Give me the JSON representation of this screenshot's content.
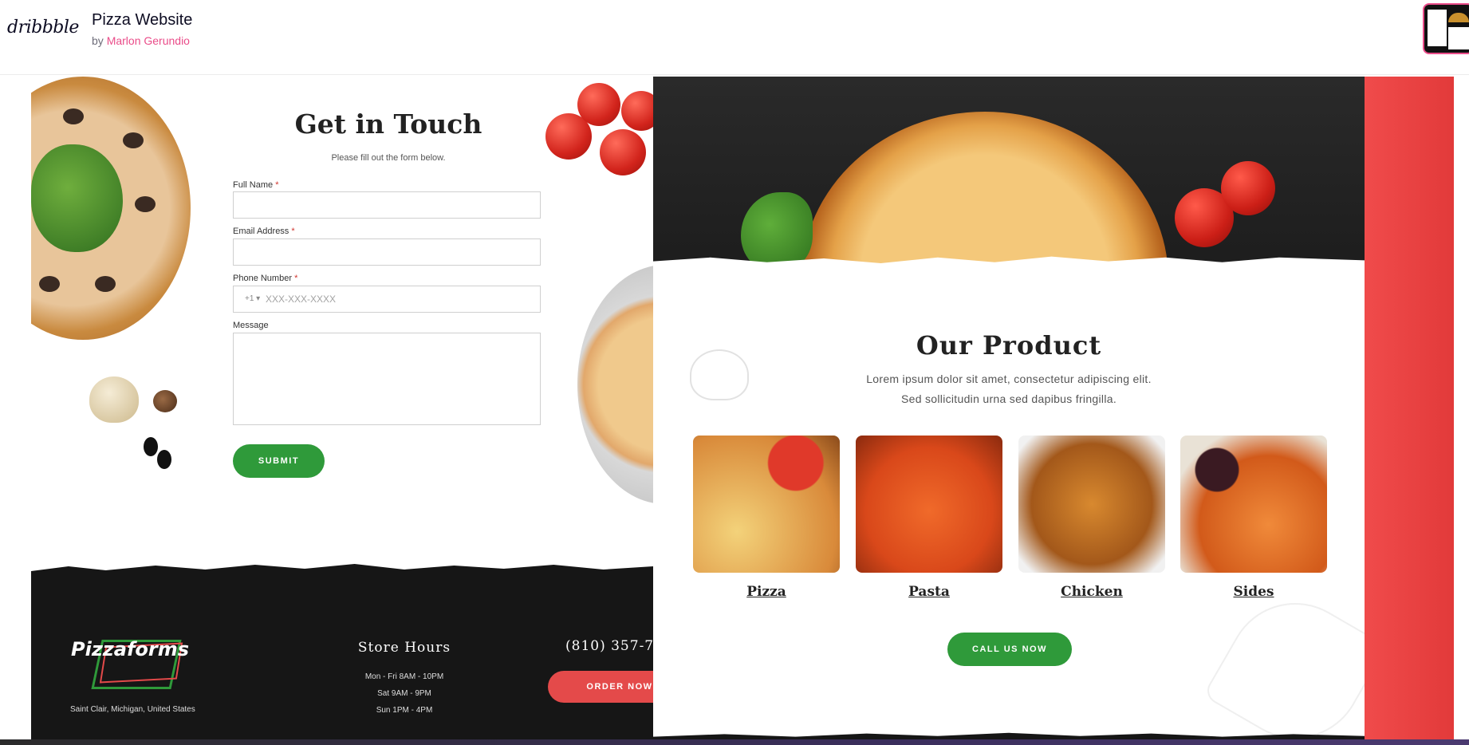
{
  "header": {
    "logo": "dribbble",
    "shot_title": "Pizza Website",
    "by_prefix": "by",
    "author": "Marlon Gerundio"
  },
  "contact_form": {
    "title": "Get in Touch",
    "subtitle": "Please fill out the form below.",
    "full_name_label": "Full Name",
    "email_label": "Email Address",
    "phone_label": "Phone Number",
    "phone_prefix": "+1 ▾",
    "phone_placeholder": "XXX-XXX-XXXX",
    "message_label": "Message",
    "required_marker": "*",
    "submit_label": "SUBMIT"
  },
  "footer": {
    "brand": "Pizzaforms",
    "address": "Saint Clair, Michigan, United States",
    "hours_title": "Store Hours",
    "hours": [
      "Mon - Fri 8AM - 10PM",
      "Sat 9AM - 9PM",
      "Sun 1PM - 4PM"
    ],
    "phone": "(810) 357-7",
    "order_label": "ORDER NOW"
  },
  "product": {
    "title": "Our Product",
    "desc_line1": "Lorem ipsum dolor sit amet, consectetur adipiscing elit.",
    "desc_line2": "Sed sollicitudin urna sed dapibus fringilla.",
    "items": [
      {
        "label": "Pizza"
      },
      {
        "label": "Pasta"
      },
      {
        "label": "Chicken"
      },
      {
        "label": "Sides"
      }
    ],
    "call_label": "CALL US NOW"
  },
  "colors": {
    "accent_green": "#2f9a3a",
    "accent_red": "#e44a4a",
    "dribbble_pink": "#ea4c89",
    "dark": "#161616"
  }
}
